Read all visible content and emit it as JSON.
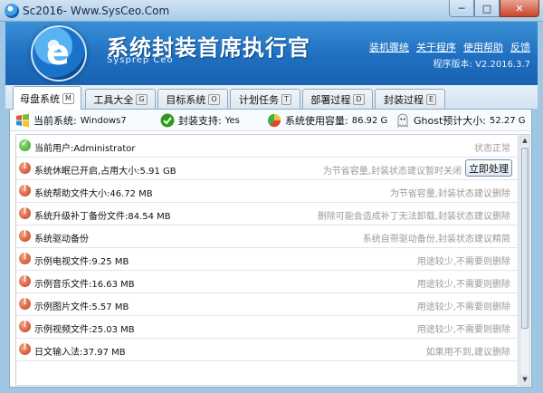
{
  "window": {
    "title": "Sc2016- Www.SysCeo.Com",
    "min_label": "─",
    "max_label": "□",
    "close_label": "✕"
  },
  "header": {
    "title": "系统封装首席执行官",
    "subtitle": "Sysprep Ceo",
    "links": [
      "装机骤统",
      "关于程序",
      "使用帮助",
      "反馈"
    ],
    "version": "程序版本: V2.2016.3.7"
  },
  "tabs": [
    {
      "label": "母盘系统",
      "key": "M"
    },
    {
      "label": "工具大全",
      "key": "G"
    },
    {
      "label": "目标系统",
      "key": "O"
    },
    {
      "label": "计划任务",
      "key": "T"
    },
    {
      "label": "部署过程",
      "key": "D"
    },
    {
      "label": "封装过程",
      "key": "E"
    }
  ],
  "status": {
    "current_system": {
      "label": "当前系统:",
      "value": "Windows7"
    },
    "seal_support": {
      "label": "封装支持:",
      "value": "Yes"
    },
    "disk_usage": {
      "label": "系统使用容量:",
      "value": "86.92 G"
    },
    "ghost_size": {
      "label": "Ghost预计大小:",
      "value": "52.27 G"
    }
  },
  "items": [
    {
      "status": "ok",
      "name": "当前用户:Administrator",
      "hint": "状态正常"
    },
    {
      "status": "warn",
      "name": "系统休眠已开启,占用大小:5.91 GB",
      "hint": "为节省容量,封装状态建议暂时关闭",
      "button": "立即处理"
    },
    {
      "status": "warn",
      "name": "系统帮助文件大小:46.72 MB",
      "hint": "为节省容量,封装状态建议删除"
    },
    {
      "status": "warn",
      "name": "系统升级补丁备份文件:84.54 MB",
      "hint": "删除可能会造成补丁无法卸载,封装状态建议删除"
    },
    {
      "status": "warn",
      "name": "系统驱动备份",
      "hint": "系统自带驱动备份,封装状态建议精简"
    },
    {
      "status": "warn",
      "name": "示例电视文件:9.25 MB",
      "hint": "用途较少,不需要则删除"
    },
    {
      "status": "warn",
      "name": "示例音乐文件:16.63 MB",
      "hint": "用途较少,不需要则删除"
    },
    {
      "status": "warn",
      "name": "示例图片文件:5.57 MB",
      "hint": "用途较少,不需要则删除"
    },
    {
      "status": "warn",
      "name": "示例视频文件:25.03 MB",
      "hint": "用途较少,不需要则删除"
    },
    {
      "status": "warn",
      "name": "日文输入法:37.97 MB",
      "hint": "如果用不到,建议删除"
    }
  ],
  "icons": {
    "ok": "check-circle-icon",
    "warn": "exclamation-circle-icon"
  },
  "colors": {
    "banner": "#1f6fc0",
    "ok": "#2f9a20",
    "warn": "#c8381a",
    "hint": "#9a9a9a"
  }
}
